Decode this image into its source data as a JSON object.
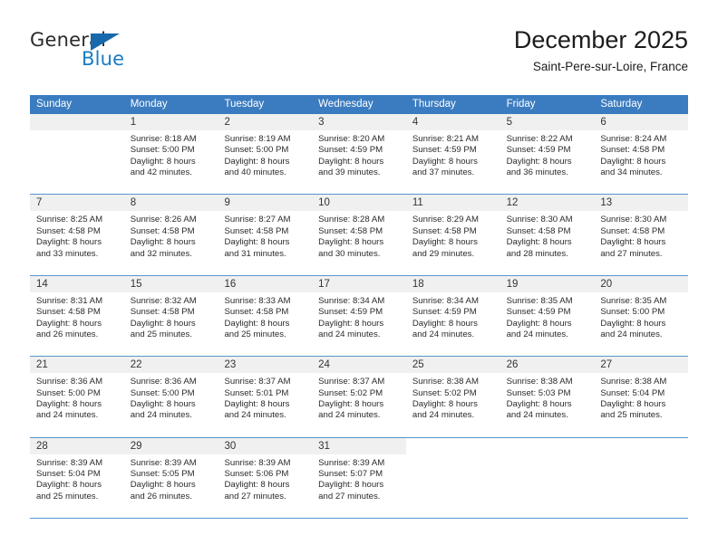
{
  "brand": {
    "name_part1": "General",
    "name_part2": "Blue",
    "accent_color": "#1a7cc2",
    "triangle_color": "#1769ab"
  },
  "header": {
    "title": "December 2025",
    "subtitle": "Saint-Pere-sur-Loire, France"
  },
  "calendar": {
    "header_bg": "#3b7cc0",
    "daynum_bg": "#f0f0f0",
    "separator_color": "#5a94cd",
    "weekdays": [
      "Sunday",
      "Monday",
      "Tuesday",
      "Wednesday",
      "Thursday",
      "Friday",
      "Saturday"
    ],
    "weeks": [
      [
        {
          "day": "",
          "lines": []
        },
        {
          "day": "1",
          "lines": [
            "Sunrise: 8:18 AM",
            "Sunset: 5:00 PM",
            "Daylight: 8 hours",
            "and 42 minutes."
          ]
        },
        {
          "day": "2",
          "lines": [
            "Sunrise: 8:19 AM",
            "Sunset: 5:00 PM",
            "Daylight: 8 hours",
            "and 40 minutes."
          ]
        },
        {
          "day": "3",
          "lines": [
            "Sunrise: 8:20 AM",
            "Sunset: 4:59 PM",
            "Daylight: 8 hours",
            "and 39 minutes."
          ]
        },
        {
          "day": "4",
          "lines": [
            "Sunrise: 8:21 AM",
            "Sunset: 4:59 PM",
            "Daylight: 8 hours",
            "and 37 minutes."
          ]
        },
        {
          "day": "5",
          "lines": [
            "Sunrise: 8:22 AM",
            "Sunset: 4:59 PM",
            "Daylight: 8 hours",
            "and 36 minutes."
          ]
        },
        {
          "day": "6",
          "lines": [
            "Sunrise: 8:24 AM",
            "Sunset: 4:58 PM",
            "Daylight: 8 hours",
            "and 34 minutes."
          ]
        }
      ],
      [
        {
          "day": "7",
          "lines": [
            "Sunrise: 8:25 AM",
            "Sunset: 4:58 PM",
            "Daylight: 8 hours",
            "and 33 minutes."
          ]
        },
        {
          "day": "8",
          "lines": [
            "Sunrise: 8:26 AM",
            "Sunset: 4:58 PM",
            "Daylight: 8 hours",
            "and 32 minutes."
          ]
        },
        {
          "day": "9",
          "lines": [
            "Sunrise: 8:27 AM",
            "Sunset: 4:58 PM",
            "Daylight: 8 hours",
            "and 31 minutes."
          ]
        },
        {
          "day": "10",
          "lines": [
            "Sunrise: 8:28 AM",
            "Sunset: 4:58 PM",
            "Daylight: 8 hours",
            "and 30 minutes."
          ]
        },
        {
          "day": "11",
          "lines": [
            "Sunrise: 8:29 AM",
            "Sunset: 4:58 PM",
            "Daylight: 8 hours",
            "and 29 minutes."
          ]
        },
        {
          "day": "12",
          "lines": [
            "Sunrise: 8:30 AM",
            "Sunset: 4:58 PM",
            "Daylight: 8 hours",
            "and 28 minutes."
          ]
        },
        {
          "day": "13",
          "lines": [
            "Sunrise: 8:30 AM",
            "Sunset: 4:58 PM",
            "Daylight: 8 hours",
            "and 27 minutes."
          ]
        }
      ],
      [
        {
          "day": "14",
          "lines": [
            "Sunrise: 8:31 AM",
            "Sunset: 4:58 PM",
            "Daylight: 8 hours",
            "and 26 minutes."
          ]
        },
        {
          "day": "15",
          "lines": [
            "Sunrise: 8:32 AM",
            "Sunset: 4:58 PM",
            "Daylight: 8 hours",
            "and 25 minutes."
          ]
        },
        {
          "day": "16",
          "lines": [
            "Sunrise: 8:33 AM",
            "Sunset: 4:58 PM",
            "Daylight: 8 hours",
            "and 25 minutes."
          ]
        },
        {
          "day": "17",
          "lines": [
            "Sunrise: 8:34 AM",
            "Sunset: 4:59 PM",
            "Daylight: 8 hours",
            "and 24 minutes."
          ]
        },
        {
          "day": "18",
          "lines": [
            "Sunrise: 8:34 AM",
            "Sunset: 4:59 PM",
            "Daylight: 8 hours",
            "and 24 minutes."
          ]
        },
        {
          "day": "19",
          "lines": [
            "Sunrise: 8:35 AM",
            "Sunset: 4:59 PM",
            "Daylight: 8 hours",
            "and 24 minutes."
          ]
        },
        {
          "day": "20",
          "lines": [
            "Sunrise: 8:35 AM",
            "Sunset: 5:00 PM",
            "Daylight: 8 hours",
            "and 24 minutes."
          ]
        }
      ],
      [
        {
          "day": "21",
          "lines": [
            "Sunrise: 8:36 AM",
            "Sunset: 5:00 PM",
            "Daylight: 8 hours",
            "and 24 minutes."
          ]
        },
        {
          "day": "22",
          "lines": [
            "Sunrise: 8:36 AM",
            "Sunset: 5:00 PM",
            "Daylight: 8 hours",
            "and 24 minutes."
          ]
        },
        {
          "day": "23",
          "lines": [
            "Sunrise: 8:37 AM",
            "Sunset: 5:01 PM",
            "Daylight: 8 hours",
            "and 24 minutes."
          ]
        },
        {
          "day": "24",
          "lines": [
            "Sunrise: 8:37 AM",
            "Sunset: 5:02 PM",
            "Daylight: 8 hours",
            "and 24 minutes."
          ]
        },
        {
          "day": "25",
          "lines": [
            "Sunrise: 8:38 AM",
            "Sunset: 5:02 PM",
            "Daylight: 8 hours",
            "and 24 minutes."
          ]
        },
        {
          "day": "26",
          "lines": [
            "Sunrise: 8:38 AM",
            "Sunset: 5:03 PM",
            "Daylight: 8 hours",
            "and 24 minutes."
          ]
        },
        {
          "day": "27",
          "lines": [
            "Sunrise: 8:38 AM",
            "Sunset: 5:04 PM",
            "Daylight: 8 hours",
            "and 25 minutes."
          ]
        }
      ],
      [
        {
          "day": "28",
          "lines": [
            "Sunrise: 8:39 AM",
            "Sunset: 5:04 PM",
            "Daylight: 8 hours",
            "and 25 minutes."
          ]
        },
        {
          "day": "29",
          "lines": [
            "Sunrise: 8:39 AM",
            "Sunset: 5:05 PM",
            "Daylight: 8 hours",
            "and 26 minutes."
          ]
        },
        {
          "day": "30",
          "lines": [
            "Sunrise: 8:39 AM",
            "Sunset: 5:06 PM",
            "Daylight: 8 hours",
            "and 27 minutes."
          ]
        },
        {
          "day": "31",
          "lines": [
            "Sunrise: 8:39 AM",
            "Sunset: 5:07 PM",
            "Daylight: 8 hours",
            "and 27 minutes."
          ]
        },
        {
          "day": "",
          "lines": [],
          "blank": true
        },
        {
          "day": "",
          "lines": [],
          "blank": true
        },
        {
          "day": "",
          "lines": [],
          "blank": true
        }
      ]
    ]
  }
}
